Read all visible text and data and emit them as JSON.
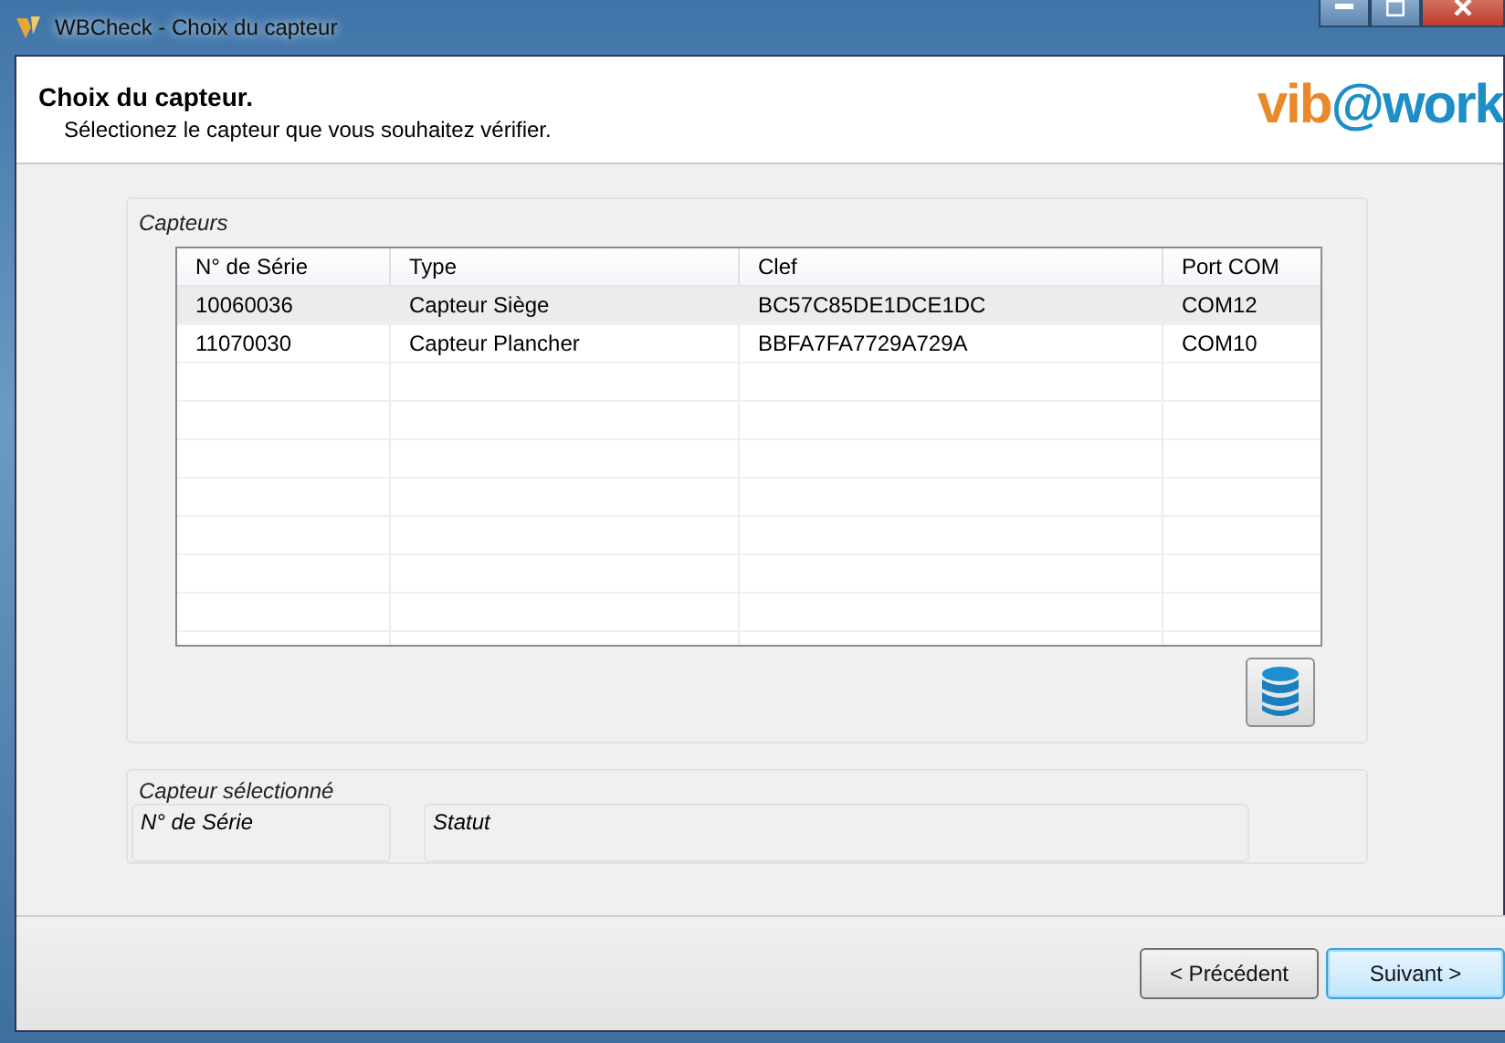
{
  "window": {
    "title": "WBCheck - Choix du capteur"
  },
  "header": {
    "title": "Choix du capteur.",
    "subtitle": "Sélectionez le capteur que vous souhaitez vérifier.",
    "logo": {
      "part1": "vib",
      "part2": "@work"
    }
  },
  "sensors_group": {
    "title": "Capteurs",
    "columns": [
      "N° de Série",
      "Type",
      "Clef",
      "Port COM"
    ],
    "rows": [
      {
        "cells": [
          "10060036",
          "Capteur Siège",
          "BC57C85DE1DCE1DC",
          "COM12"
        ],
        "selected": true
      },
      {
        "cells": [
          "11070030",
          "Capteur Plancher",
          "BBFA7FA7729A729A",
          "COM10"
        ],
        "selected": false
      }
    ]
  },
  "selected_group": {
    "title": "Capteur sélectionné",
    "fields": [
      "N° de Série",
      "Statut"
    ]
  },
  "buttons": [
    {
      "label": "< Précédent",
      "default": false
    },
    {
      "label": "Suivant >",
      "default": true
    }
  ]
}
